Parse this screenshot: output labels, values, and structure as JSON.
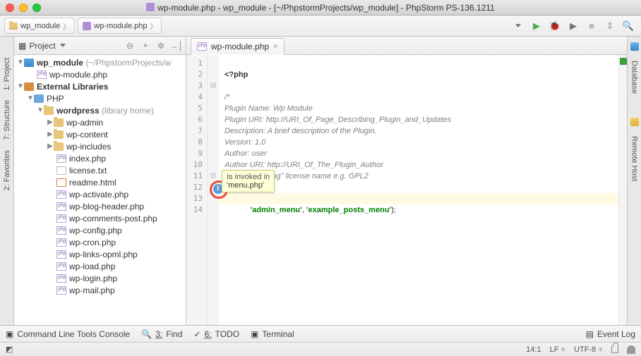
{
  "window": {
    "title": "wp-module.php - wp_module - [~/PhpstormProjects/wp_module] - PhpStorm PS-136.1211"
  },
  "breadcrumb": {
    "root": "wp_module",
    "file": "wp-module.php"
  },
  "project_panel": {
    "title": "Project"
  },
  "tree": {
    "root_name": "wp_module",
    "root_hint": "(~/PhpstormProjects/w",
    "main_file": "wp-module.php",
    "ext_lib": "External Libraries",
    "php": "PHP",
    "wordpress": "wordpress",
    "wordpress_hint": "(library home)",
    "dirs": [
      "wp-admin",
      "wp-content",
      "wp-includes"
    ],
    "files": [
      "index.php",
      "license.txt",
      "readme.html",
      "wp-activate.php",
      "wp-blog-header.php",
      "wp-comments-post.php",
      "wp-config.php",
      "wp-cron.php",
      "wp-links-opml.php",
      "wp-load.php",
      "wp-login.php",
      "wp-mail.php"
    ]
  },
  "tab": {
    "label": "wp-module.php"
  },
  "code": {
    "l1": "<?php",
    "l3": "/*",
    "l4": "Plugin Name: Wp Module",
    "l5": "Plugin URI: http://URI_Of_Page_Describing_Plugin_and_Updates",
    "l6": "Description: A brief description of the Plugin.",
    "l7": "Version: 1.0",
    "l8": "Author: user",
    "l9": "Author URI: http://URI_Of_The_Plugin_Author",
    "l10": "License: A \"Slug\" license name e.g. GPL2",
    "l11": "*/",
    "l13a": "'admin_menu'",
    "l13b": "'example_posts_menu'"
  },
  "tooltip": {
    "line1": "Is invoked in",
    "line2": "'menu.php'"
  },
  "rails": {
    "project": "1: Project",
    "structure": "7: Structure",
    "favorites": "2: Favorites",
    "database": "Database",
    "remote": "Remote Host"
  },
  "bottom": {
    "cli": "Command Line Tools Console",
    "find": "Find",
    "find_n": "3:",
    "todo": "TODO",
    "todo_n": "6:",
    "terminal": "Terminal",
    "eventlog": "Event Log"
  },
  "status": {
    "pos": "14:1",
    "le": "LF",
    "enc": "UTF-8"
  }
}
